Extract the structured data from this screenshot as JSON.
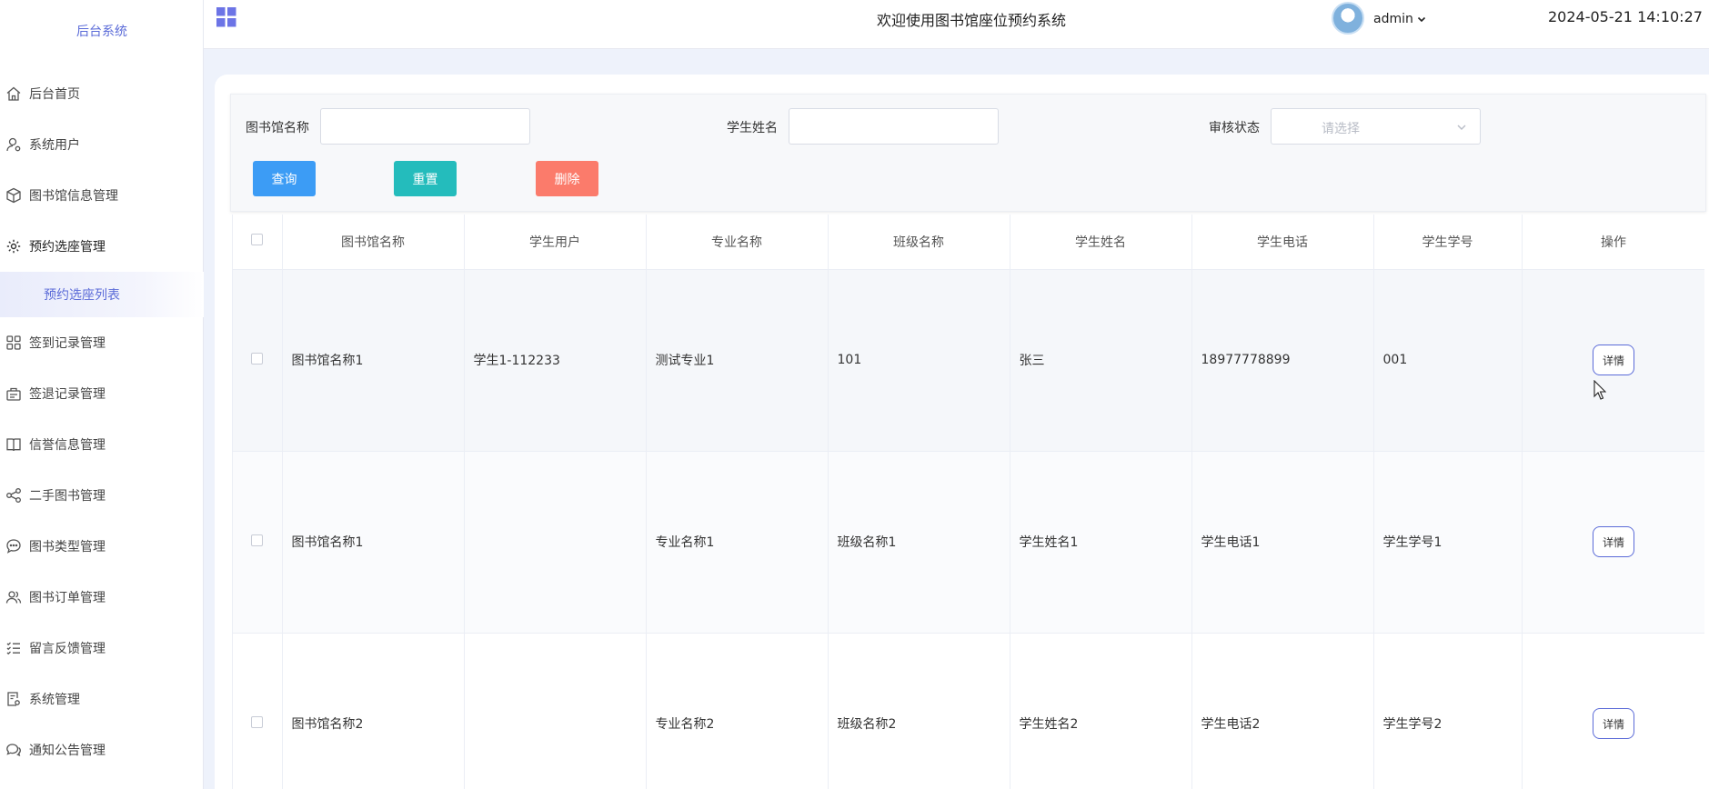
{
  "sidebar": {
    "brand": "后台系统",
    "items": [
      {
        "label": "后台首页",
        "icon": "home-icon"
      },
      {
        "label": "系统用户",
        "icon": "user-gear-icon"
      },
      {
        "label": "图书馆信息管理",
        "icon": "cube-icon"
      },
      {
        "label": "预约选座管理",
        "icon": "gear-icon"
      },
      {
        "label": "签到记录管理",
        "icon": "grid-icon"
      },
      {
        "label": "签退记录管理",
        "icon": "briefcase-icon"
      },
      {
        "label": "信誉信息管理",
        "icon": "book-icon"
      },
      {
        "label": "二手图书管理",
        "icon": "share-icon"
      },
      {
        "label": "图书类型管理",
        "icon": "chat-icon"
      },
      {
        "label": "图书订单管理",
        "icon": "users-icon"
      },
      {
        "label": "留言反馈管理",
        "icon": "list-icon"
      },
      {
        "label": "系统管理",
        "icon": "settings-doc-icon"
      },
      {
        "label": "通知公告管理",
        "icon": "chat-bubbles-icon"
      }
    ],
    "submenu": {
      "label": "预约选座列表"
    }
  },
  "header": {
    "title": "欢迎使用图书馆座位预约系统",
    "user": "admin",
    "time": "2024-05-21 14:10:27"
  },
  "filters": {
    "library_label": "图书馆名称",
    "library_value": "",
    "student_label": "学生姓名",
    "student_value": "",
    "status_label": "审核状态",
    "status_placeholder": "请选择",
    "search_btn": "查询",
    "reset_btn": "重置",
    "delete_btn": "删除"
  },
  "table": {
    "headers": [
      "图书馆名称",
      "学生用户",
      "专业名称",
      "班级名称",
      "学生姓名",
      "学生电话",
      "学生学号",
      "操作"
    ],
    "rows": [
      [
        "图书馆名称1",
        "学生1-112233",
        "测试专业1",
        "101",
        "张三",
        "18977778899",
        "001"
      ],
      [
        "图书馆名称1",
        "",
        "专业名称1",
        "班级名称1",
        "学生姓名1",
        "学生电话1",
        "学生学号1"
      ],
      [
        "图书馆名称2",
        "",
        "专业名称2",
        "班级名称2",
        "学生姓名2",
        "学生电话2",
        "学生学号2"
      ]
    ],
    "detail_label": "详情"
  },
  "colors": {
    "accent": "#5b6bd8",
    "search": "#3c9cf5",
    "reset": "#24bcbc",
    "delete": "#fb7b6b"
  }
}
